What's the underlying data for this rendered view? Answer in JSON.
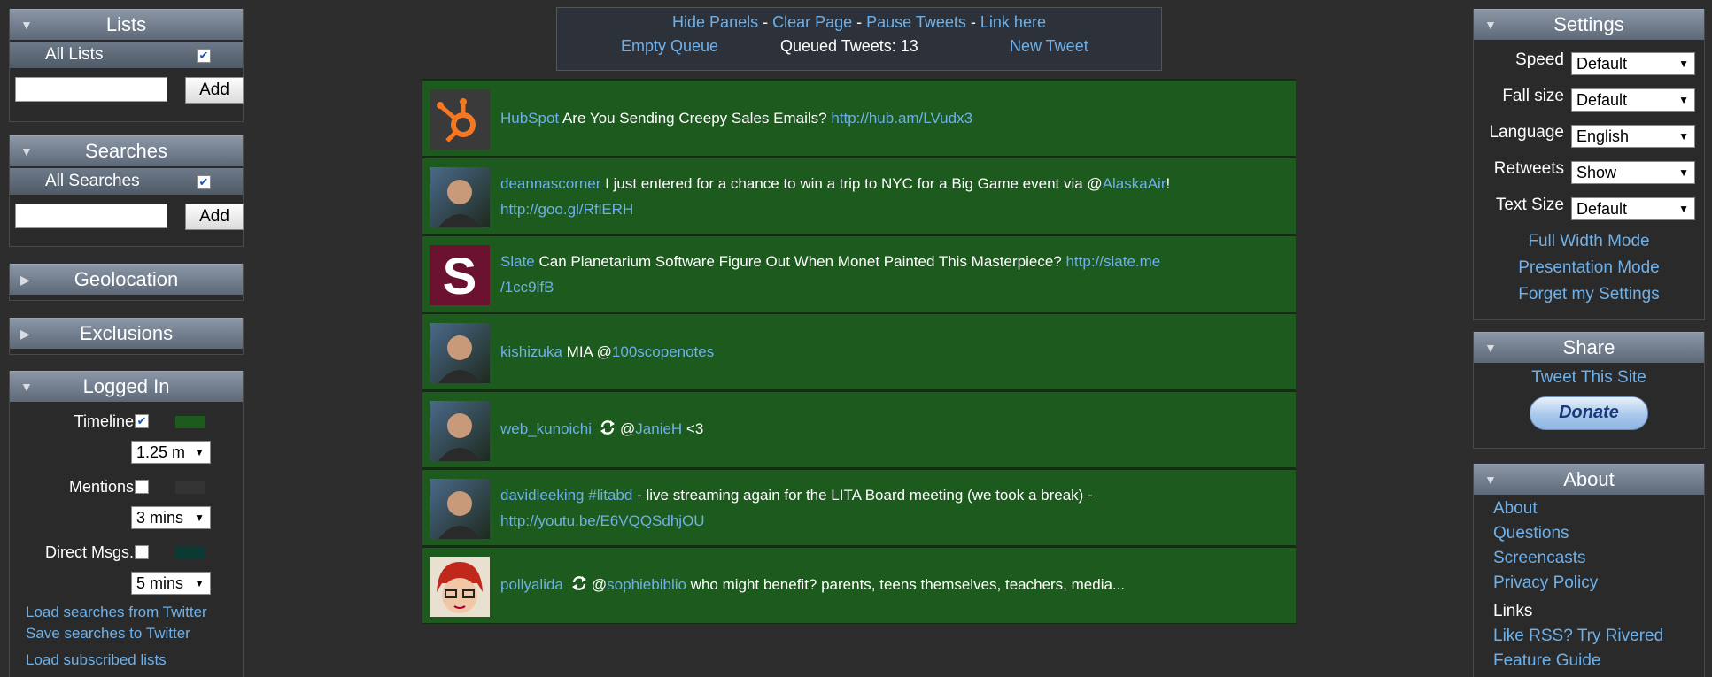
{
  "header": {
    "links": [
      "Hide Panels",
      "Clear Page",
      "Pause Tweets",
      "Link here"
    ],
    "separator": " - ",
    "empty_queue": "Empty Queue",
    "queued_label": "Queued Tweets: 13",
    "new_tweet": "New Tweet"
  },
  "lists": {
    "title": "Lists",
    "all_label": "All Lists",
    "all_checked": true,
    "input_value": "",
    "add_label": "Add"
  },
  "searches": {
    "title": "Searches",
    "all_label": "All Searches",
    "all_checked": true,
    "input_value": "",
    "add_label": "Add"
  },
  "geolocation": {
    "title": "Geolocation"
  },
  "exclusions": {
    "title": "Exclusions"
  },
  "logged_in": {
    "title": "Logged In",
    "timeline": {
      "label": "Timeline",
      "checked": true,
      "interval": "1.25 m",
      "color": "#1d5a1d"
    },
    "mentions": {
      "label": "Mentions",
      "checked": false,
      "interval": "3 mins",
      "color": "#333333"
    },
    "direct": {
      "label": "Direct Msgs.",
      "checked": false,
      "interval": "5 mins",
      "color": "#0c3a33"
    },
    "links": [
      "Load searches from Twitter",
      "Save searches to Twitter",
      "Load subscribed lists"
    ]
  },
  "tweets": [
    {
      "user": "HubSpot",
      "text": [
        {
          "t": "Are You Sending Creepy Sales Emails? "
        },
        {
          "l": "http://hub.am/LVudx3"
        }
      ],
      "avatar": "hubspot-logo",
      "retweet": false
    },
    {
      "user": "deannascorner",
      "text": [
        {
          "t": "I just entered for a chance to win a trip to NYC for a Big Game event via @"
        },
        {
          "l": "AlaskaAir"
        },
        {
          "t": "!"
        },
        {
          "br": true
        },
        {
          "l": "http://goo.gl/RflERH"
        }
      ],
      "avatar": "photo",
      "retweet": false
    },
    {
      "user": "Slate",
      "text": [
        {
          "t": "Can Planetarium Software Figure Out When Monet Painted This Masterpiece? "
        },
        {
          "l": "http://slate.me"
        },
        {
          "br": true
        },
        {
          "l": "/1cc9lfB"
        }
      ],
      "avatar": "slate-logo",
      "retweet": false
    },
    {
      "user": "kishizuka",
      "text": [
        {
          "t": "MIA @"
        },
        {
          "l": "100scopenotes"
        }
      ],
      "avatar": "photo",
      "retweet": false
    },
    {
      "user": "web_kunoichi",
      "text": [
        {
          "t": "@"
        },
        {
          "l": "JanieH"
        },
        {
          "t": " <3"
        }
      ],
      "avatar": "photo",
      "retweet": true
    },
    {
      "user": "davidleeking",
      "text": [
        {
          "t": " "
        },
        {
          "l": "#litabd"
        },
        {
          "t": " - live streaming again for the LITA Board meeting (we took a break) -"
        },
        {
          "br": true
        },
        {
          "l": "http://youtu.be/E6VQQSdhjOU"
        }
      ],
      "avatar": "photo",
      "retweet": false
    },
    {
      "user": "pollyalida",
      "text": [
        {
          "t": "@"
        },
        {
          "l": "sophiebiblio"
        },
        {
          "t": " who might benefit? parents, teens themselves, teachers, media..."
        }
      ],
      "avatar": "cartoon",
      "retweet": true
    }
  ],
  "settings": {
    "title": "Settings",
    "rows": [
      {
        "label": "Speed",
        "value": "Default"
      },
      {
        "label": "Fall size",
        "value": "Default"
      },
      {
        "label": "Language",
        "value": "English"
      },
      {
        "label": "Retweets",
        "value": "Show"
      },
      {
        "label": "Text Size",
        "value": "Default"
      }
    ],
    "links": [
      "Full Width Mode",
      "Presentation Mode",
      "Forget my Settings"
    ]
  },
  "share": {
    "title": "Share",
    "tweet_site": "Tweet This Site",
    "donate": "Donate"
  },
  "about": {
    "title": "About",
    "links": [
      "About",
      "Questions",
      "Screencasts",
      "Privacy Policy"
    ],
    "links_heading": "Links",
    "links2": [
      "Like RSS? Try Rivered",
      "Feature Guide"
    ]
  }
}
